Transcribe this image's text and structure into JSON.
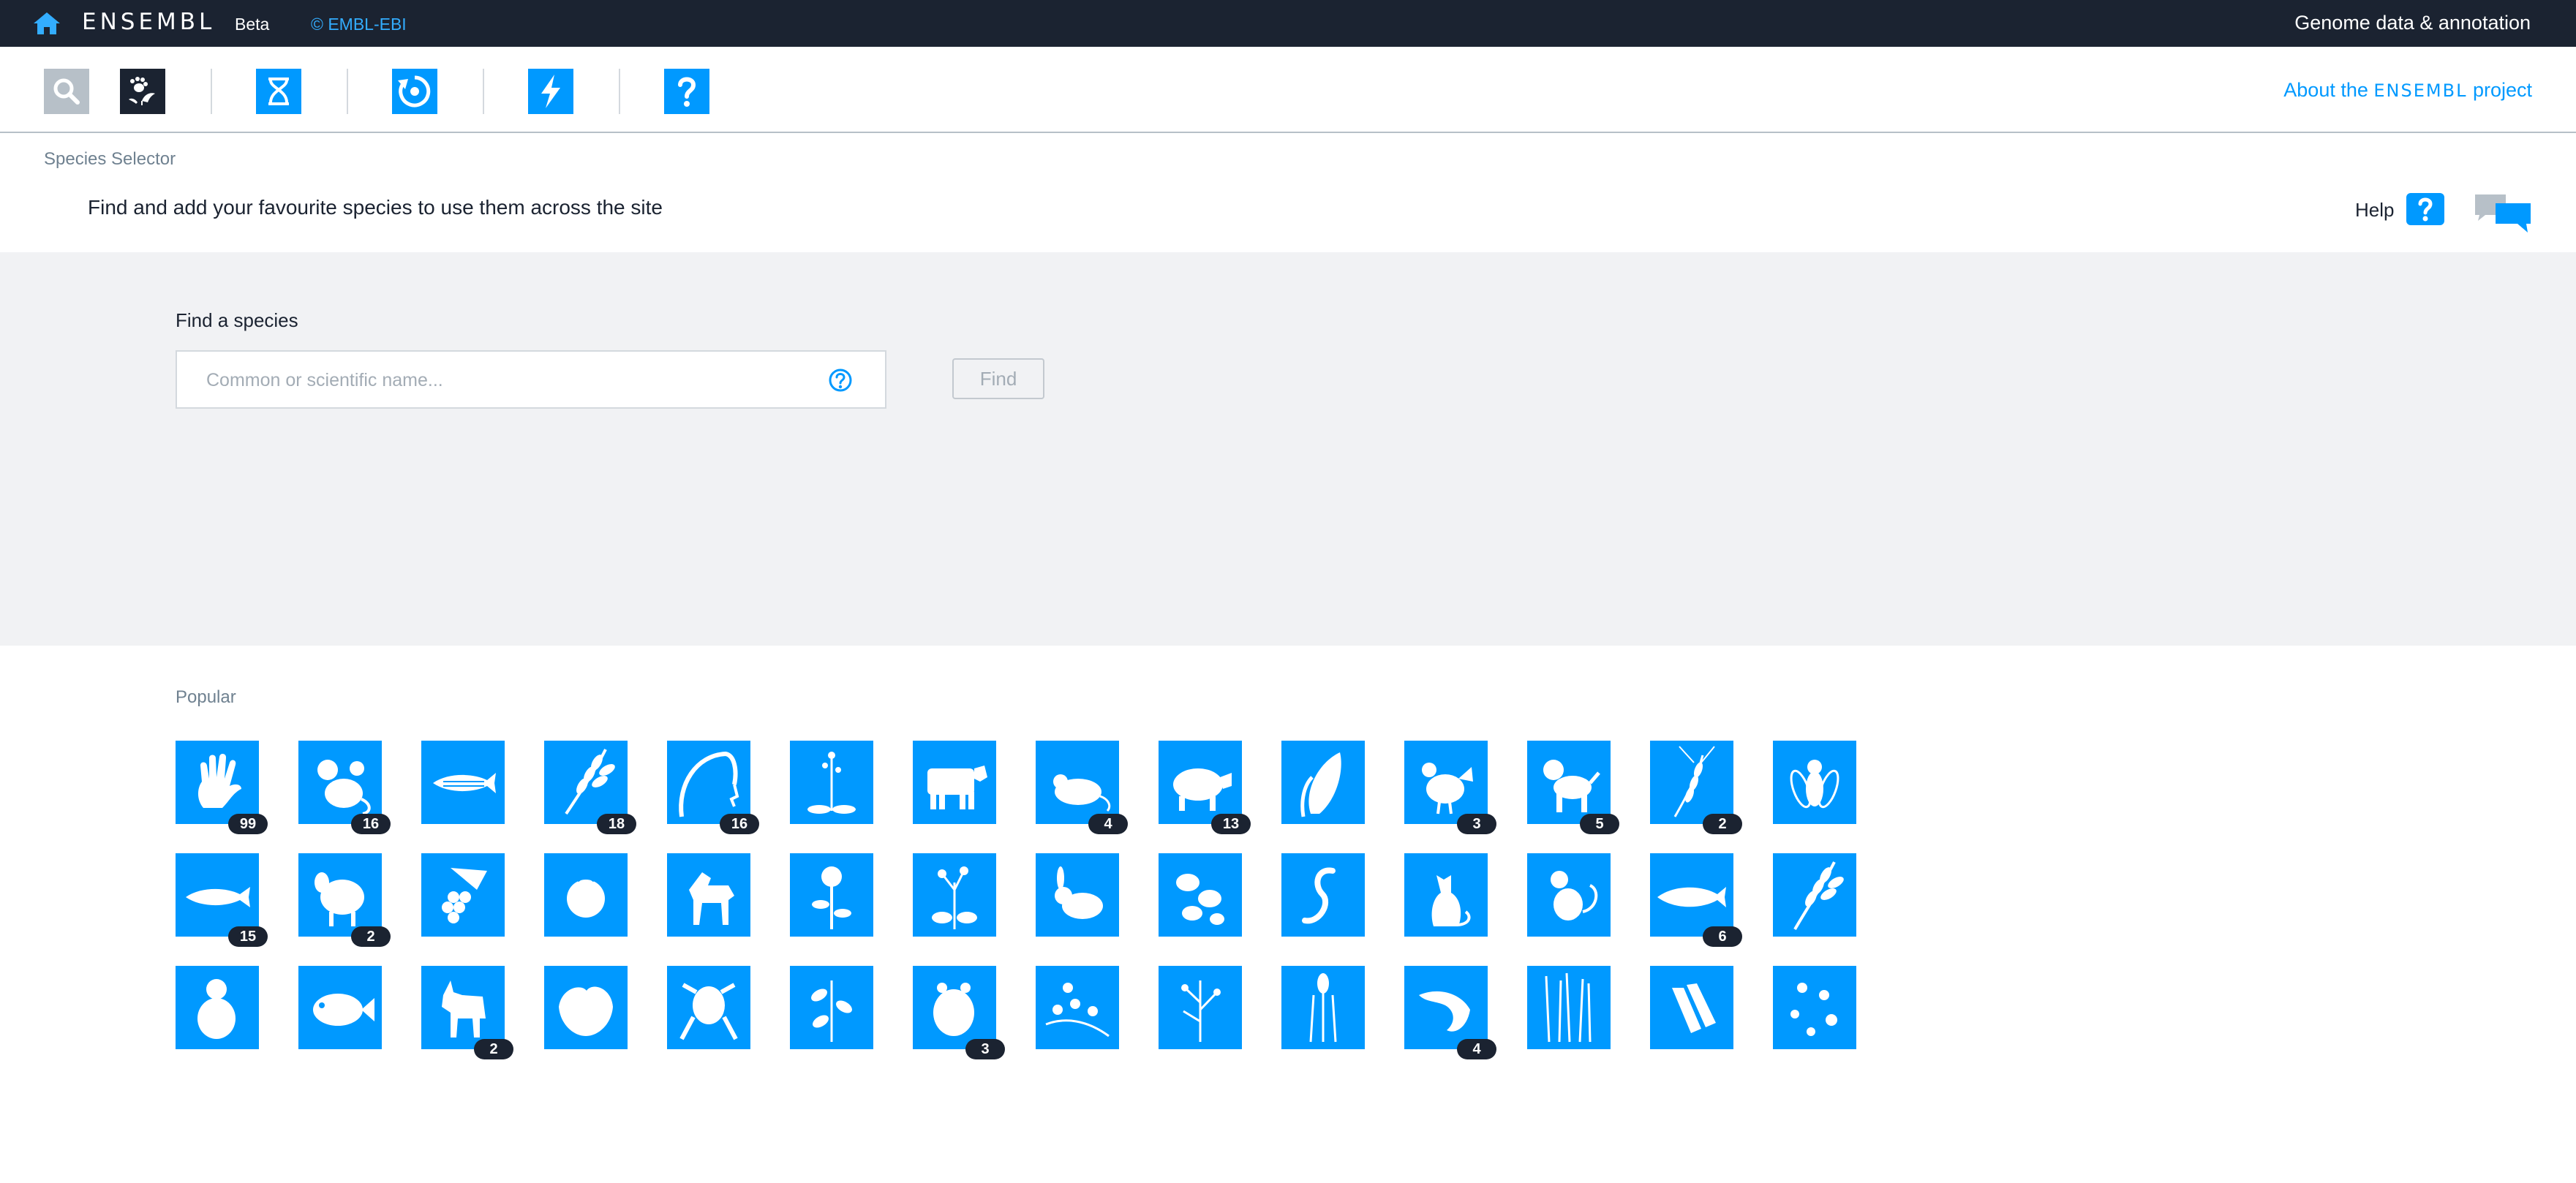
{
  "topbar": {
    "brand": "ENSEMBL",
    "beta": "Beta",
    "copyright": "© EMBL-EBI",
    "tagline": "Genome data & annotation"
  },
  "launchbar": {
    "about_prefix": "About the ",
    "about_brand": "ENSEMBL",
    "about_suffix": " project",
    "icons": [
      "search-icon",
      "species-selector-icon",
      "genome-browser-icon",
      "entity-viewer-icon",
      "tools-icon",
      "help-icon"
    ]
  },
  "header": {
    "title": "Species Selector",
    "subtitle": "Find and add your favourite species to use them across the site",
    "help_label": "Help"
  },
  "search": {
    "label": "Find a species",
    "placeholder": "Common or scientific name...",
    "value": "",
    "button": "Find"
  },
  "popular": {
    "label": "Popular",
    "species": [
      {
        "icon": "human-hand-icon",
        "count": "99"
      },
      {
        "icon": "mouse-icon",
        "count": "16"
      },
      {
        "icon": "zebrafish-icon",
        "count": ""
      },
      {
        "icon": "wheat-icon",
        "count": "18"
      },
      {
        "icon": "rice-icon",
        "count": "16"
      },
      {
        "icon": "arabidopsis-icon",
        "count": ""
      },
      {
        "icon": "cow-icon",
        "count": ""
      },
      {
        "icon": "rat-icon",
        "count": "4"
      },
      {
        "icon": "pig-icon",
        "count": "13"
      },
      {
        "icon": "maize-icon",
        "count": ""
      },
      {
        "icon": "chicken-icon",
        "count": "3"
      },
      {
        "icon": "dog-icon",
        "count": "5"
      },
      {
        "icon": "barley-icon",
        "count": "2"
      },
      {
        "icon": "fruit-fly-icon",
        "count": ""
      },
      {
        "icon": "trout-icon",
        "count": "15"
      },
      {
        "icon": "sheep-icon",
        "count": "2"
      },
      {
        "icon": "grape-icon",
        "count": ""
      },
      {
        "icon": "tomato-icon",
        "count": ""
      },
      {
        "icon": "horse-icon",
        "count": ""
      },
      {
        "icon": "sunflower-icon",
        "count": ""
      },
      {
        "icon": "brassica-icon",
        "count": ""
      },
      {
        "icon": "rabbit-icon",
        "count": ""
      },
      {
        "icon": "potato-icon",
        "count": ""
      },
      {
        "icon": "worm-icon",
        "count": ""
      },
      {
        "icon": "cat-icon",
        "count": ""
      },
      {
        "icon": "monkey-icon",
        "count": ""
      },
      {
        "icon": "fish-icon",
        "count": "6"
      },
      {
        "icon": "oat-icon",
        "count": ""
      },
      {
        "icon": "bear-icon",
        "count": ""
      },
      {
        "icon": "tilapia-icon",
        "count": ""
      },
      {
        "icon": "goat-icon",
        "count": "2"
      },
      {
        "icon": "lettuce-icon",
        "count": ""
      },
      {
        "icon": "frog-icon",
        "count": ""
      },
      {
        "icon": "soybean-icon",
        "count": ""
      },
      {
        "icon": "hamster-icon",
        "count": "3"
      },
      {
        "icon": "clover-icon",
        "count": ""
      },
      {
        "icon": "herb-icon",
        "count": ""
      },
      {
        "icon": "sorghum-icon",
        "count": ""
      },
      {
        "icon": "salmon-icon",
        "count": "4"
      },
      {
        "icon": "grass-icon",
        "count": ""
      },
      {
        "icon": "banana-icon",
        "count": ""
      },
      {
        "icon": "yeast-icon",
        "count": ""
      }
    ]
  },
  "colors": {
    "brand_blue": "#0099ff",
    "dark": "#1b2331",
    "grey_band": "#f1f2f4"
  }
}
